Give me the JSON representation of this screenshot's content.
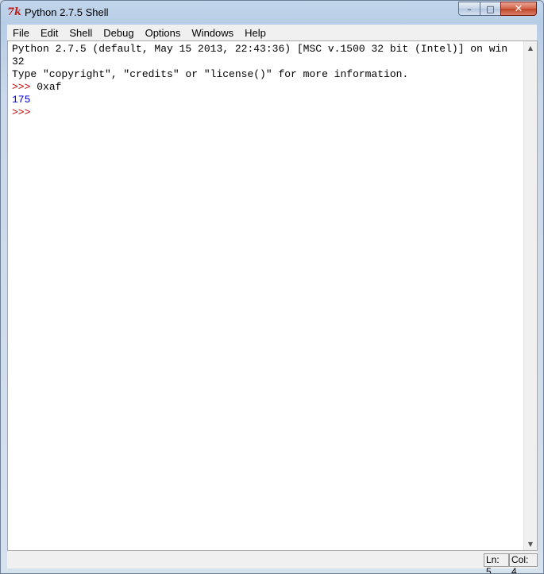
{
  "window": {
    "title": "Python 2.7.5 Shell",
    "icon": "tk-feather-icon",
    "controls": {
      "minimize": "–",
      "maximize": "□",
      "close": "✕"
    }
  },
  "menu": [
    {
      "label": "File"
    },
    {
      "label": "Edit"
    },
    {
      "label": "Shell"
    },
    {
      "label": "Debug"
    },
    {
      "label": "Options"
    },
    {
      "label": "Windows"
    },
    {
      "label": "Help"
    }
  ],
  "shell": {
    "lines": [
      {
        "type": "out",
        "text": "Python 2.7.5 (default, May 15 2013, 22:43:36) [MSC v.1500 32 bit (Intel)] on win"
      },
      {
        "type": "out",
        "text": "32"
      },
      {
        "type": "out",
        "text": "Type \"copyright\", \"credits\" or \"license()\" for more information."
      },
      {
        "type": "prompt",
        "prompt": ">>> ",
        "text": "0xaf"
      },
      {
        "type": "result",
        "text": "175"
      },
      {
        "type": "prompt",
        "prompt": ">>> ",
        "text": ""
      }
    ]
  },
  "status": {
    "ln": "Ln: 5",
    "col": "Col: 4"
  },
  "colors": {
    "prompt": "#c00000",
    "result": "#0000c8",
    "output": "#000000"
  }
}
